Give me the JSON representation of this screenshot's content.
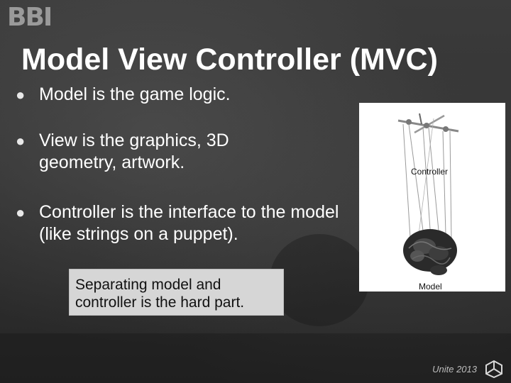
{
  "slide": {
    "logo_text": "BBI",
    "title": "Model View Controller (MVC)",
    "bullets": [
      {
        "text": "Model is the game logic."
      },
      {
        "text": "View is the graphics, 3D geometry, artwork."
      },
      {
        "text": "Controller is the interface to the model (like strings on a puppet)."
      }
    ],
    "bullet_glyph": "●",
    "callout_text": "Separating model and controller is the hard part.",
    "figure": {
      "controller_label": "Controller",
      "model_label": "Model"
    },
    "footer_text": "Unite 2013",
    "icons": {
      "logo": "bbi-logo",
      "unity": "unity-logo-icon"
    },
    "colors": {
      "background": "#333333",
      "title": "#ffffff",
      "callout_bg": "#d6d6d6"
    }
  }
}
